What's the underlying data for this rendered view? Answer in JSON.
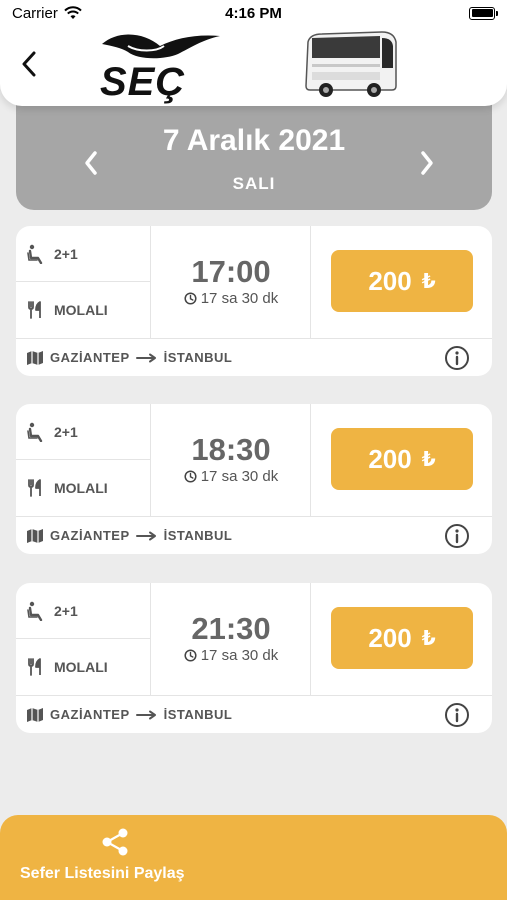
{
  "status_bar": {
    "carrier": "Carrier",
    "time": "4:16 PM"
  },
  "header": {
    "logo_text": "SEÇ",
    "back_icon": "chevron-left-icon",
    "bus_image": "bus-image"
  },
  "date_selector": {
    "date": "7 Aralık 2021",
    "day": "SALI"
  },
  "trips": [
    {
      "seat_layout": "2+1",
      "break_label": "MOLALI",
      "departure": "17:00",
      "duration": "17 sa 30 dk",
      "price": "200",
      "currency": "₺",
      "origin": "GAZİANTEP",
      "destination": "İSTANBUL"
    },
    {
      "seat_layout": "2+1",
      "break_label": "MOLALI",
      "departure": "18:30",
      "duration": "17 sa 30 dk",
      "price": "200",
      "currency": "₺",
      "origin": "GAZİANTEP",
      "destination": "İSTANBUL"
    },
    {
      "seat_layout": "2+1",
      "break_label": "MOLALI",
      "departure": "21:30",
      "duration": "17 sa 30 dk",
      "price": "200",
      "currency": "₺",
      "origin": "GAZİANTEP",
      "destination": "İSTANBUL"
    }
  ],
  "share": {
    "label": "Sefer Listesini Paylaş"
  },
  "colors": {
    "accent": "#efb443",
    "date_bar": "#a6a6a6",
    "background": "#ececec"
  }
}
